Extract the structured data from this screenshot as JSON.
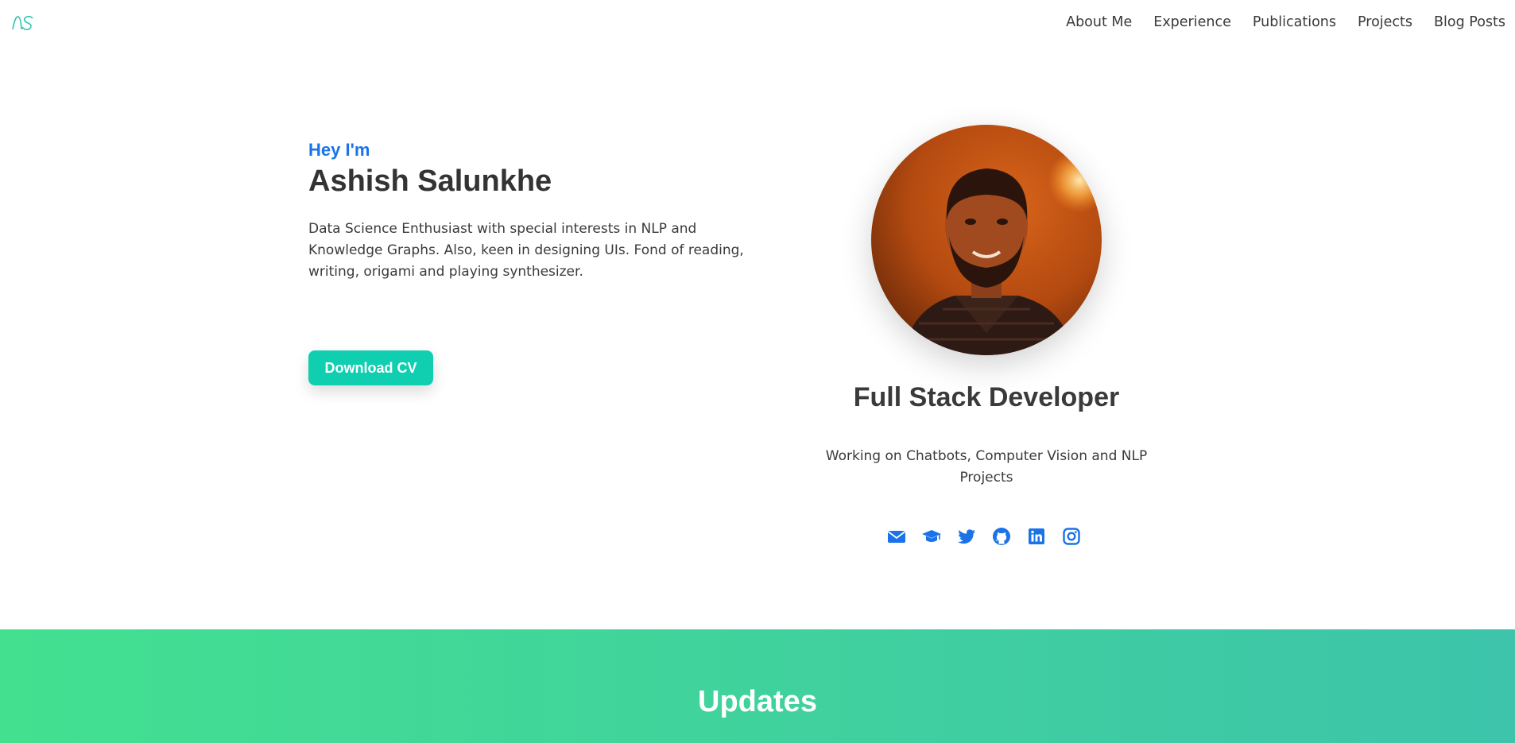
{
  "nav": {
    "logo_text": "AS",
    "links": [
      "About Me",
      "Experience",
      "Publications",
      "Projects",
      "Blog Posts"
    ]
  },
  "hero": {
    "greeting": "Hey I'm",
    "name": "Ashish Salunkhe",
    "bio": "Data Science Enthusiast with special interests in NLP and Knowledge Graphs. Also, keen in designing UIs. Fond of reading, writing, origami and playing synthesizer.",
    "cv_button": "Download CV"
  },
  "profile": {
    "role": "Full Stack Developer",
    "description": "Working on Chatbots, Computer Vision and NLP Projects",
    "socials": [
      "envelope-icon",
      "graduation-cap-icon",
      "twitter-icon",
      "github-icon",
      "linkedin-icon",
      "instagram-icon"
    ]
  },
  "updates": {
    "title": "Updates"
  },
  "colors": {
    "accent_blue": "#1a73e8",
    "button_teal": "#0fcfb0",
    "logo_teal": "#2cc5b0",
    "updates_gradient_start": "#43e090",
    "updates_gradient_end": "#3dc4aa"
  }
}
